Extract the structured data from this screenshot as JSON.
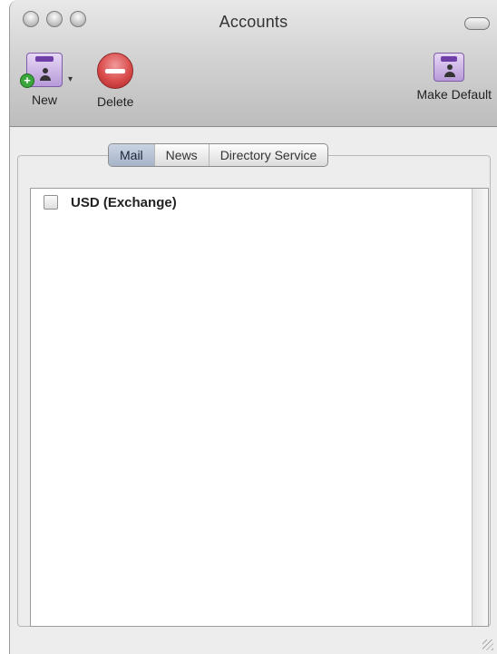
{
  "window": {
    "title": "Accounts"
  },
  "toolbar": {
    "new_label": "New",
    "delete_label": "Delete",
    "make_default_label": "Make Default"
  },
  "tabs": [
    {
      "label": "Mail",
      "selected": true
    },
    {
      "label": "News",
      "selected": false
    },
    {
      "label": "Directory Service",
      "selected": false
    }
  ],
  "accounts": [
    {
      "label": "USD (Exchange)",
      "checked": false
    }
  ],
  "icons": {
    "new": "new-account-icon",
    "delete": "delete-icon",
    "make_default": "make-default-icon"
  },
  "colors": {
    "selected_tab": "#a7b4c8",
    "delete_red": "#d94b4b",
    "add_green": "#3aa53a"
  }
}
